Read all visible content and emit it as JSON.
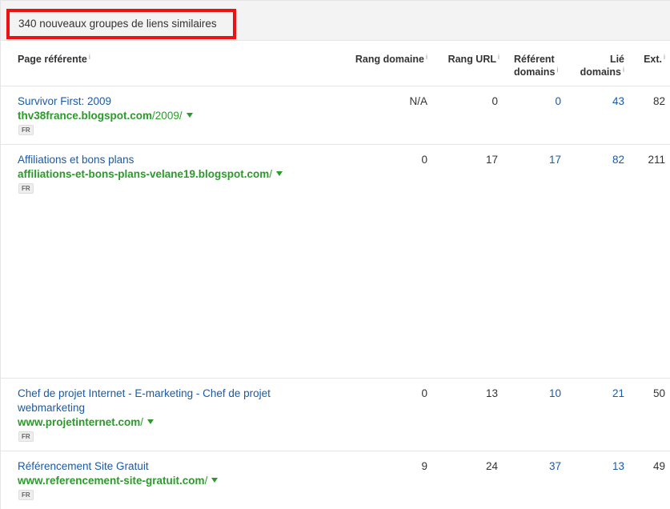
{
  "summary": {
    "text": "340 nouveaux groupes de liens similaires"
  },
  "columns": {
    "page": "Page référente",
    "rang_domaine": "Rang domaine",
    "rang_url": "Rang URL",
    "referent_line1": "Référent",
    "referent_line2": "domains",
    "lie_line1": "Lié",
    "lie_line2": "domains",
    "ext": "Ext.",
    "info_glyph": "i"
  },
  "rows": [
    {
      "title": "Survivor First: 2009",
      "domain": "thv38france.blogspot.com",
      "path": "/2009/",
      "lang": "FR",
      "rang_domaine": "N/A",
      "rang_url": "0",
      "referent_domains": "0",
      "lie_domains": "43",
      "ext": "82"
    },
    {
      "title": "Affiliations et bons plans",
      "domain": "affiliations-et-bons-plans-velane19.blogspot.com",
      "path": "/",
      "lang": "FR",
      "rang_domaine": "0",
      "rang_url": "17",
      "referent_domains": "17",
      "lie_domains": "82",
      "ext": "211"
    },
    {
      "title": "Chef de projet Internet - E-marketing - Chef de projet webmarketing",
      "domain": "www.projetinternet.com",
      "path": "/",
      "lang": "FR",
      "rang_domaine": "0",
      "rang_url": "13",
      "referent_domains": "10",
      "lie_domains": "21",
      "ext": "50"
    },
    {
      "title": "Référencement Site Gratuit",
      "domain": "www.referencement-site-gratuit.com",
      "path": "/",
      "lang": "FR",
      "rang_domaine": "9",
      "rang_url": "24",
      "referent_domains": "37",
      "lie_domains": "13",
      "ext": "49"
    }
  ],
  "colors": {
    "highlight_border": "#ee1111",
    "link_blue": "#1a5aa6",
    "url_green": "#2b9a2b"
  }
}
